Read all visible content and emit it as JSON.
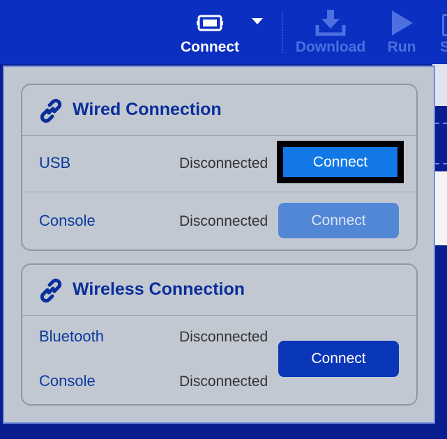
{
  "toolbar": {
    "connect_label": "Connect",
    "connect_icon": "device-icon",
    "download_label": "Download",
    "download_icon": "download-icon",
    "run_label": "Run",
    "run_icon": "play-icon",
    "stub_label": "S"
  },
  "colors": {
    "toolbar_bg": "#0b2fc0",
    "panel_bg": "#bfc6d1",
    "title_blue": "#0a2e9a",
    "button_active": "#1178e6",
    "button_disabled": "#5287d6",
    "button_dark": "#0a36b8"
  },
  "wired": {
    "title": "Wired Connection",
    "icon": "link-icon",
    "rows": [
      {
        "label": "USB",
        "status": "Disconnected",
        "button": "Connect"
      },
      {
        "label": "Console",
        "status": "Disconnected",
        "button": "Connect"
      }
    ]
  },
  "wireless": {
    "title": "Wireless Connection",
    "icon": "link-icon",
    "rows": [
      {
        "label": "Bluetooth",
        "status": "Disconnected"
      },
      {
        "label": "Console",
        "status": "Disconnected"
      }
    ],
    "button": "Connect"
  }
}
